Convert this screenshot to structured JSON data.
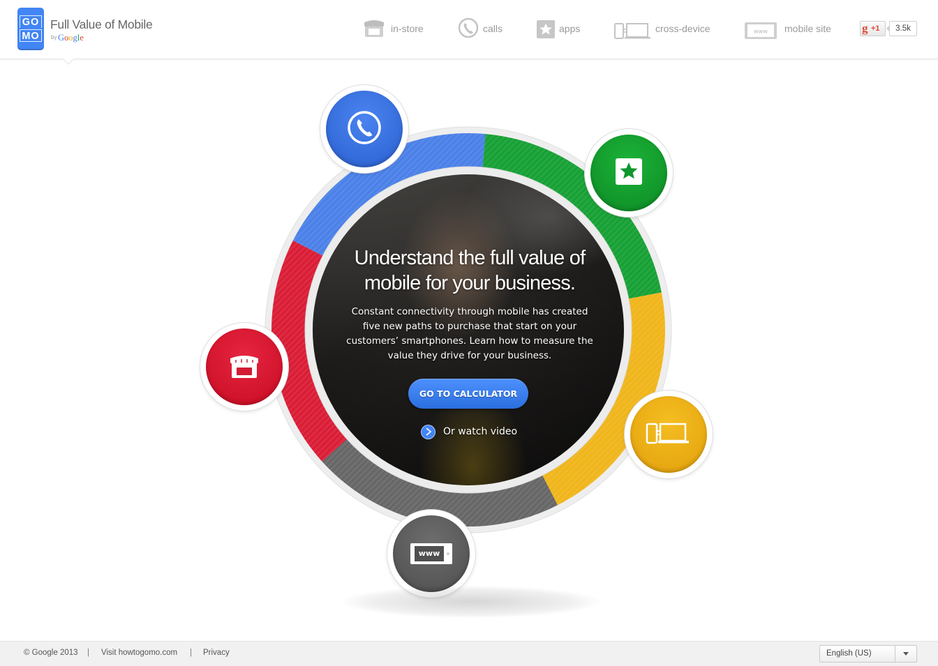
{
  "header": {
    "logo_lines": [
      "GO",
      "MO"
    ],
    "title": "Full Value of Mobile",
    "by": "by",
    "google": [
      "G",
      "o",
      "o",
      "g",
      "l",
      "e"
    ],
    "nav": [
      {
        "label": "in-store",
        "icon": "store-icon"
      },
      {
        "label": "calls",
        "icon": "phone-icon"
      },
      {
        "label": "apps",
        "icon": "star-icon"
      },
      {
        "label": "cross-device",
        "icon": "devices-icon"
      },
      {
        "label": "mobile site",
        "icon": "www-icon"
      }
    ],
    "plus_one": {
      "g": "g",
      "label": "+1",
      "count": "3.5k"
    }
  },
  "hero": {
    "title": "Understand the full value of mobile for your business.",
    "body": "Constant connectivity through mobile has created five new paths to purchase that start on your customers’ smartphones. Learn how to measure the value they drive for your business.",
    "cta": "GO TO CALCULATOR",
    "video_link": "Or watch video"
  },
  "channels": {
    "calls": {
      "icon": "phone-icon",
      "color": "#3367d6"
    },
    "apps": {
      "icon": "star-icon",
      "color": "#109d30"
    },
    "cross_device": {
      "icon": "devices-icon",
      "color": "#eaab12"
    },
    "mobile_site": {
      "icon": "www-icon",
      "label": "www",
      "color": "#5f5f5f"
    },
    "in_store": {
      "icon": "store-icon",
      "color": "#d9132c"
    }
  },
  "ring_colors": {
    "blue": "#4a80e8",
    "green": "#16a034",
    "yellow": "#f0b51a",
    "gray": "#666666",
    "red": "#da1c35"
  },
  "footer": {
    "copyright": "© Google 2013",
    "separator": "|",
    "visit_link": "Visit howtogomo.com",
    "privacy_link": "Privacy",
    "language": "English (US)"
  }
}
